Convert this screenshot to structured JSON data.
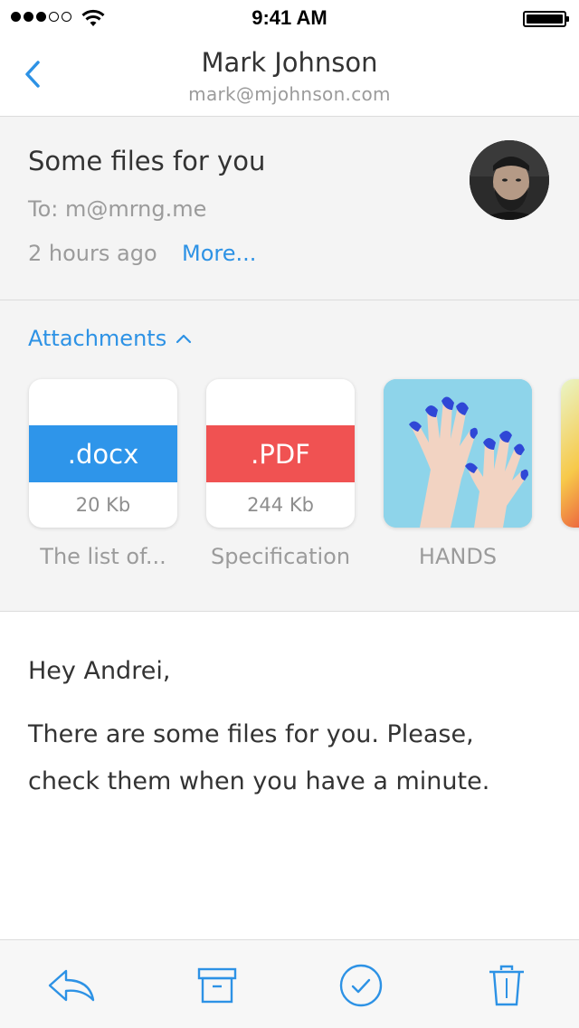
{
  "status_bar": {
    "time": "9:41 AM",
    "signal_bars": 3,
    "signal_total": 5,
    "battery_level": 1.0
  },
  "nav": {
    "title": "Mark Johnson",
    "subtitle": "mark@mjohnson.com"
  },
  "mail": {
    "subject": "Some files for you",
    "to": "To: m@mrng.me",
    "time": "2 hours ago",
    "more": "More..."
  },
  "attachments": {
    "title": "Attachments",
    "items": [
      {
        "badge": ".docx",
        "size": "20 Kb",
        "name": "The list of...",
        "color": "#2e95ea"
      },
      {
        "badge": ".PDF",
        "size": "244 Kb",
        "name": "Specification",
        "color": "#f05252"
      },
      {
        "name": "HANDS"
      }
    ]
  },
  "body": {
    "greeting": "Hey Andrei,",
    "line1": "There are some files for you. Please,",
    "line2": "check them when you have a minute."
  },
  "colors": {
    "accent": "#2d92e5",
    "background": "#f4f4f4"
  },
  "toolbar": {
    "icons": [
      "reply-icon",
      "archive-icon",
      "check-icon",
      "trash-icon"
    ]
  }
}
